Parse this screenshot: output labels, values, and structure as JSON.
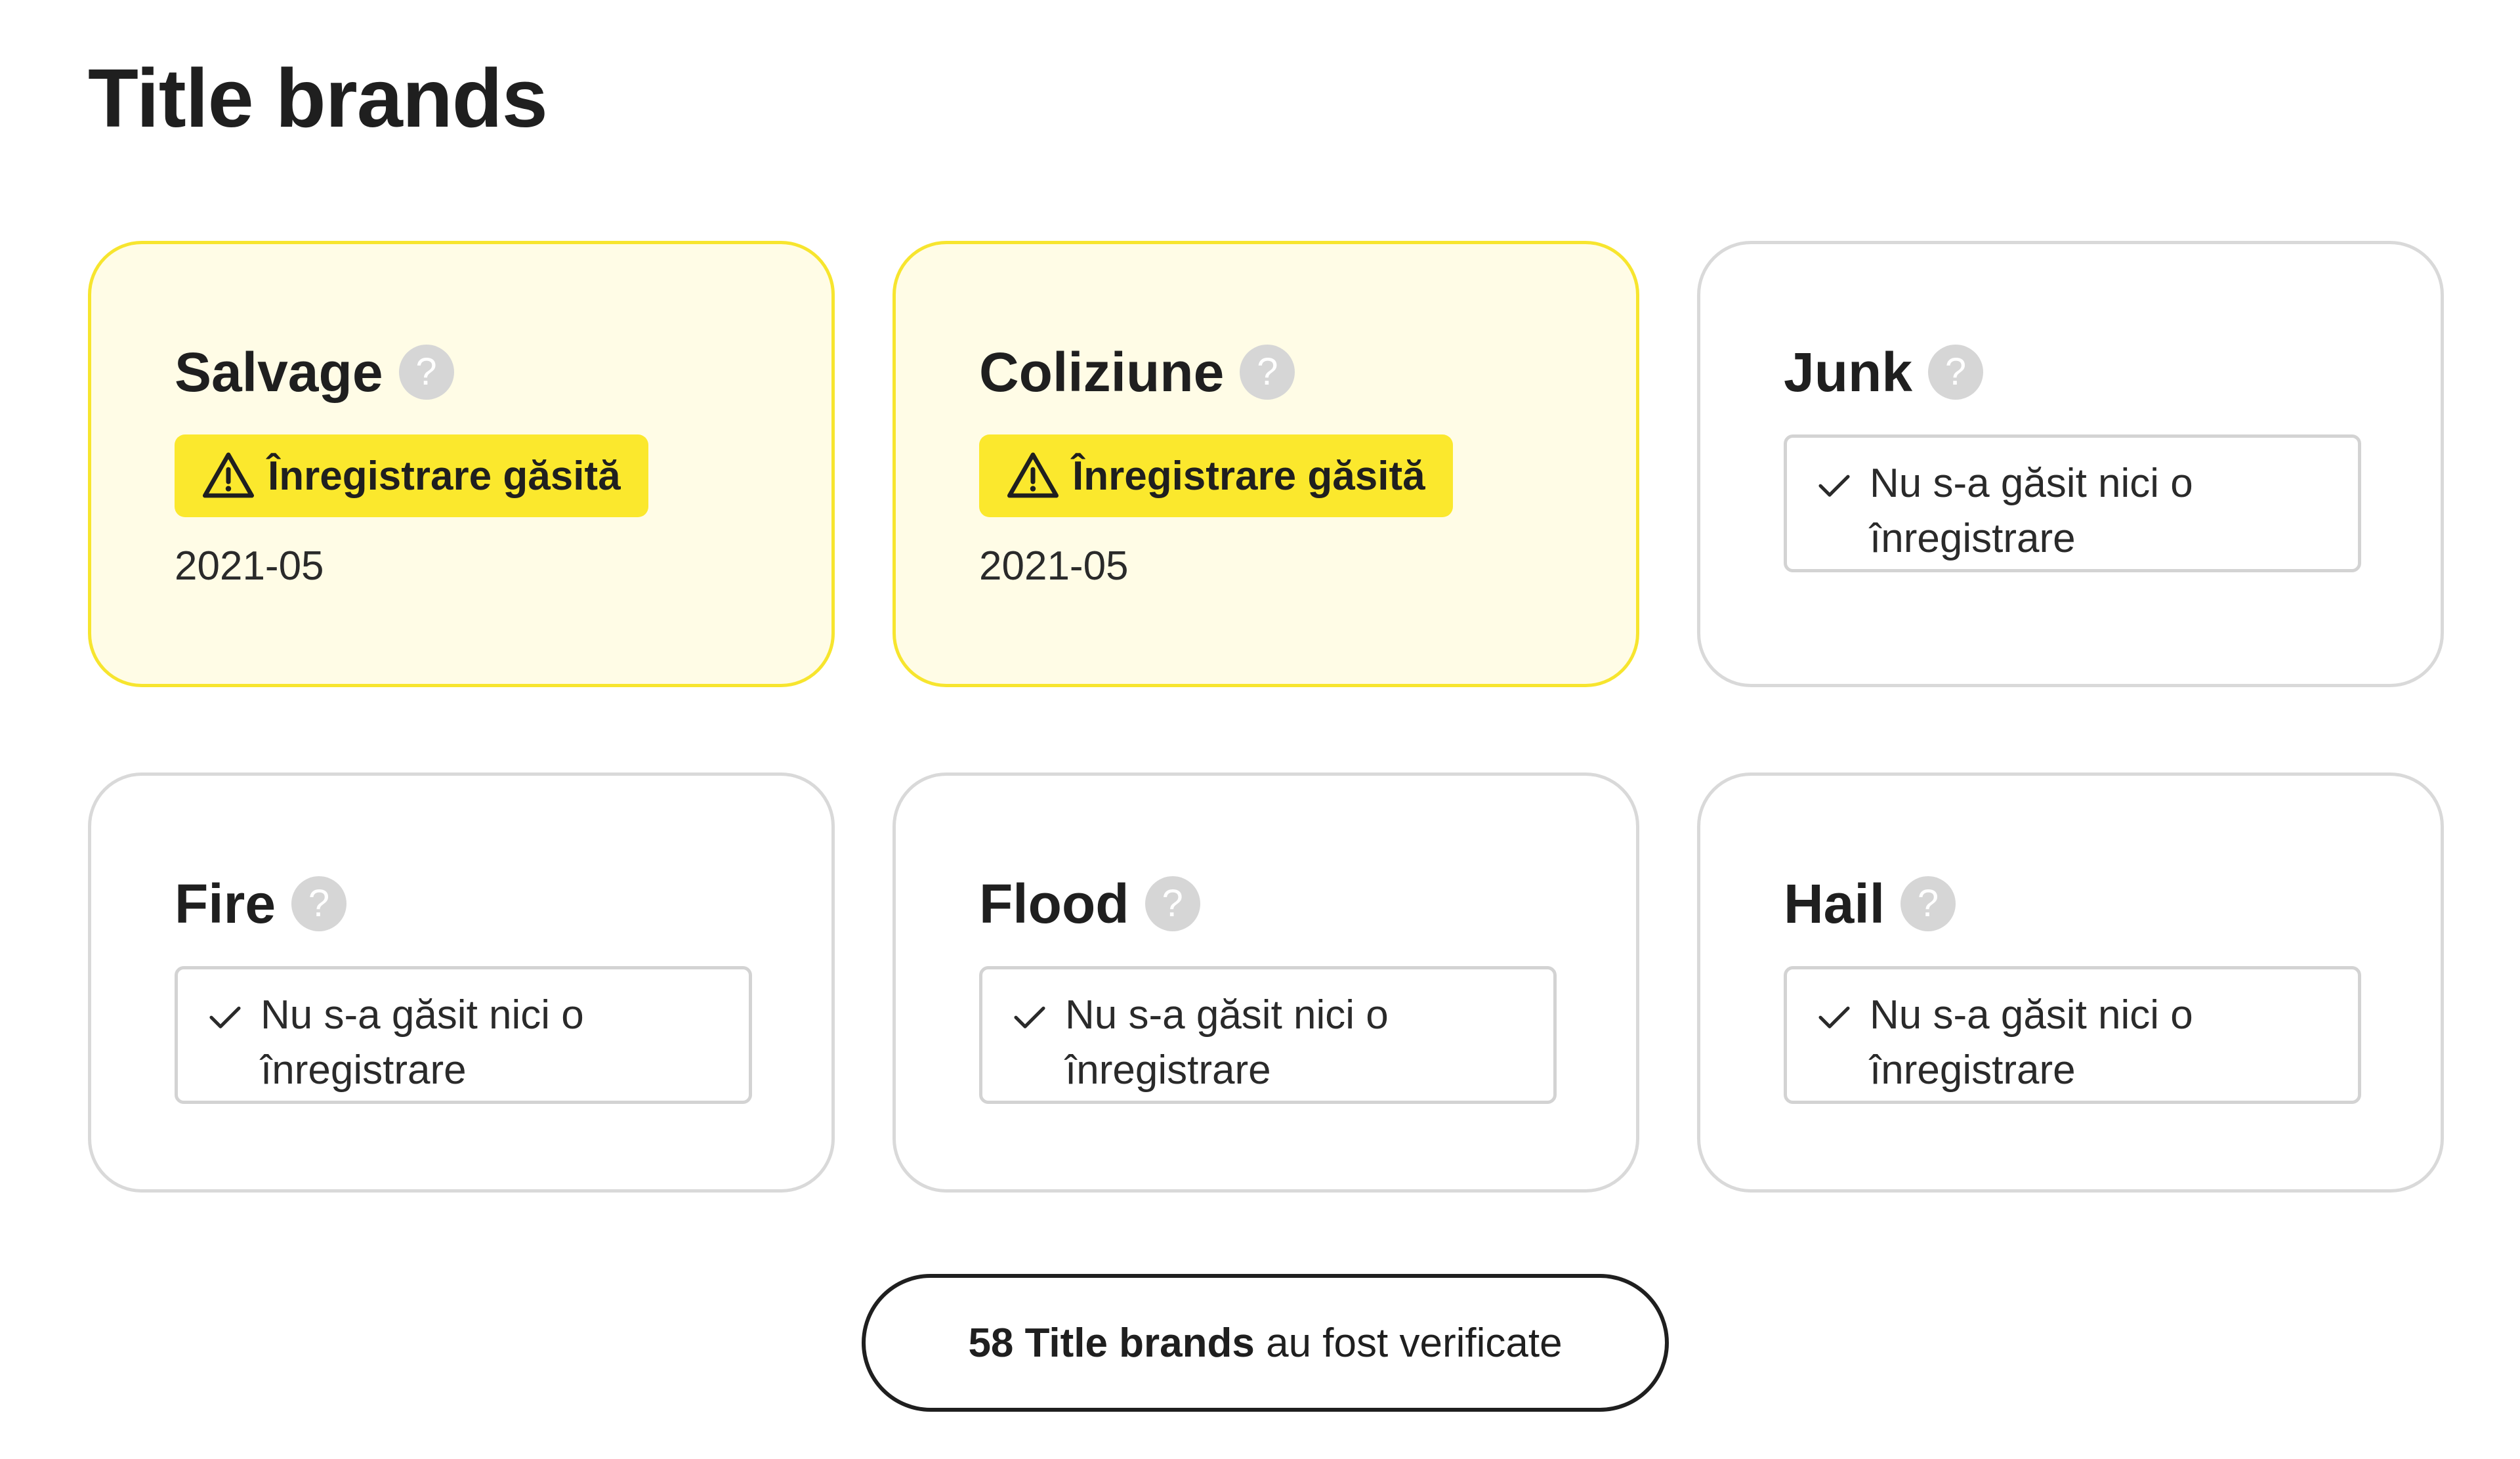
{
  "page": {
    "title": "Title brands"
  },
  "colors": {
    "flag_background": "#fffce6",
    "flag_border": "#f7e52e",
    "badge_yellow": "#fbe82d",
    "card_border": "#d9d9d9",
    "help_icon": "#d6d6d6",
    "text": "#1f1f1f"
  },
  "cards": [
    {
      "title": "Salvage",
      "help_icon": "question-icon",
      "status": "flagged",
      "badge_icon": "warning-icon",
      "badge_label": "Înregistrare găsită",
      "date": "2021-05"
    },
    {
      "title": "Coliziune",
      "help_icon": "question-icon",
      "status": "flagged",
      "badge_icon": "warning-icon",
      "badge_label": "Înregistrare găsită",
      "date": "2021-05"
    },
    {
      "title": "Junk",
      "help_icon": "question-icon",
      "status": "clear",
      "clear_icon": "check-icon",
      "clear_label": "Nu s-a găsit nici o înregistrare"
    },
    {
      "title": "Fire",
      "help_icon": "question-icon",
      "status": "clear",
      "clear_icon": "check-icon",
      "clear_label": "Nu s-a găsit nici o înregistrare"
    },
    {
      "title": "Flood",
      "help_icon": "question-icon",
      "status": "clear",
      "clear_icon": "check-icon",
      "clear_label": "Nu s-a găsit nici o înregistrare"
    },
    {
      "title": "Hail",
      "help_icon": "question-icon",
      "status": "clear",
      "clear_icon": "check-icon",
      "clear_label": "Nu s-a găsit nici o înregistrare"
    }
  ],
  "summary": {
    "bold_text": "58 Title brands",
    "text": " au fost verificate"
  }
}
